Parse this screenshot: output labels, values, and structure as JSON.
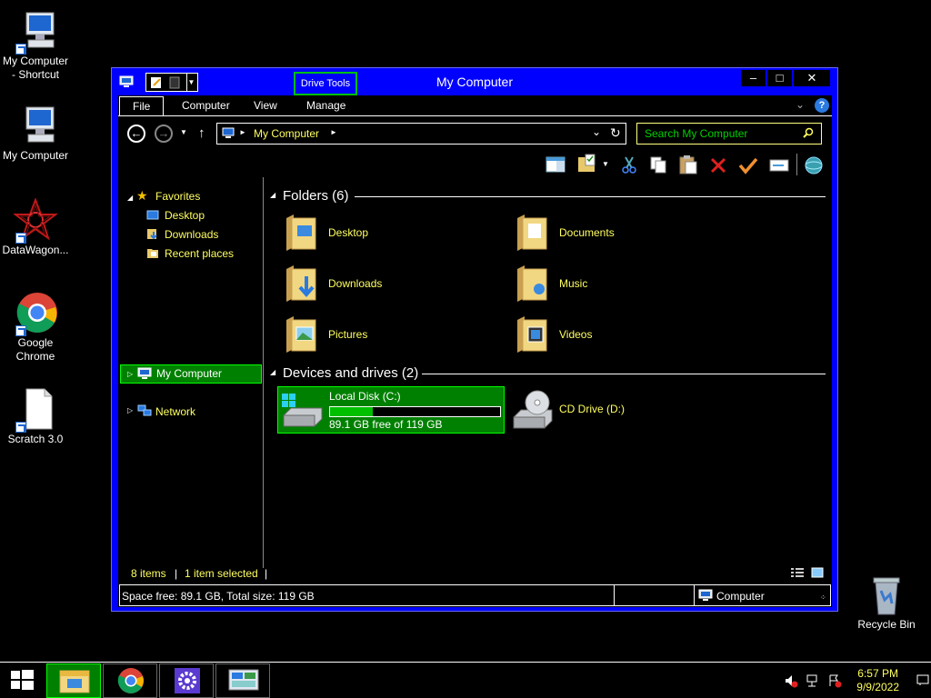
{
  "desktop": {
    "icons": [
      {
        "label": "My Computer - Shortcut"
      },
      {
        "label": "My Computer"
      },
      {
        "label": "DataWagon..."
      },
      {
        "label": "Google Chrome"
      },
      {
        "label": "Scratch 3.0"
      },
      {
        "label": "Recycle Bin"
      }
    ]
  },
  "window": {
    "title": "My Computer",
    "context_tab": "Drive Tools",
    "controls": {
      "minimize": "–",
      "maximize": "□",
      "close": "✕"
    },
    "tabs": [
      "File",
      "Computer",
      "View",
      "Manage"
    ],
    "address": {
      "path": "My Computer"
    },
    "search": {
      "placeholder": "Search My Computer"
    }
  },
  "nav": {
    "favorites": "Favorites",
    "favorites_items": [
      "Desktop",
      "Downloads",
      "Recent places"
    ],
    "my_computer": "My Computer",
    "network": "Network"
  },
  "content": {
    "folders_header": "Folders (6)",
    "folders": [
      "Desktop",
      "Documents",
      "Downloads",
      "Music",
      "Pictures",
      "Videos"
    ],
    "drives_header": "Devices and drives (2)",
    "drives": [
      {
        "name": "Local Disk (C:)",
        "free_text": "89.1 GB free of 119 GB",
        "used_fraction": 0.25
      },
      {
        "name": "CD Drive (D:)"
      }
    ]
  },
  "status": {
    "items": "8 items",
    "selected": "1 item selected",
    "details": "Space free: 89.1 GB, Total size: 119 GB",
    "location": "Computer"
  },
  "clock": {
    "time": "6:57 PM",
    "date": "9/9/2022"
  },
  "colors": {
    "window_frame": "#0000ff",
    "selection": "#008000",
    "selection_border": "#00ff00",
    "text_highlight": "#ffff60",
    "background": "#000000"
  }
}
